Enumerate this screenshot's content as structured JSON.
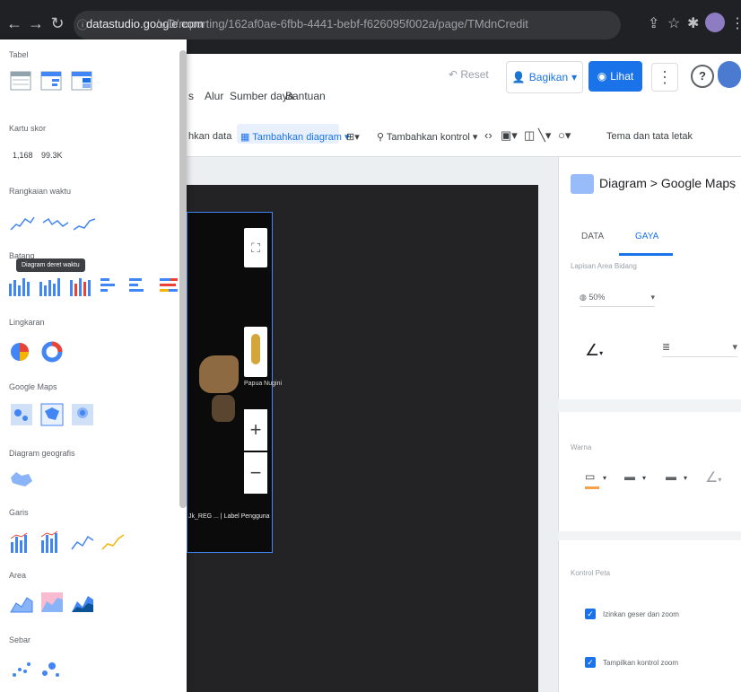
{
  "browser": {
    "url_domain": "datastudio.google.com",
    "url_path": "/u/0/reporting/162af0ae-6fbb-4441-bebf-f626095f002a/page/TMdnCredit"
  },
  "menu": {
    "items": [
      "Alur",
      "Sumber daya",
      "Bantuan"
    ],
    "partial_item": "hkan data"
  },
  "header": {
    "reset_label": "Reset",
    "share_label": "Bagikan",
    "view_label": "Lihat"
  },
  "toolbar": {
    "add_chart_label": "Tambahkan diagram",
    "add_control_label": "Tambahkan kontrol",
    "theme_label": "Tema dan tata letak"
  },
  "chart_menu": {
    "sections": [
      {
        "label": "Tabel"
      },
      {
        "label": "Kartu skor"
      },
      {
        "label": "Rangkaian waktu"
      },
      {
        "label": "Batang"
      },
      {
        "label": "Lingkaran"
      },
      {
        "label": "Google Maps"
      },
      {
        "label": "Diagram geografis"
      },
      {
        "label": "Garis"
      },
      {
        "label": "Area"
      },
      {
        "label": "Sebar"
      }
    ],
    "scorecard_values": [
      "1,168",
      "99.3K"
    ],
    "tooltip": "Diagram deret waktu"
  },
  "map": {
    "place_label": "Papua Nugini",
    "caption": "Jk_REG ... | Label Pengguna"
  },
  "panel": {
    "breadcrumb_root": "Diagram",
    "breadcrumb_sep": ">",
    "breadcrumb_leaf": "Google Maps",
    "tab_data": "DATA",
    "tab_style": "GAYA",
    "layer_label": "Lapisan Area Bidang",
    "fill_select": "50%",
    "color_section_label": "Warna",
    "map_controls_label": "Kontrol Peta",
    "checkbox1_label": "Izinkan geser dan zoom",
    "checkbox2_label": "Tampilkan kontrol zoom"
  },
  "colors": {
    "accent": "#1a73e8",
    "browser_bar": "#202124",
    "canvas": "#232326"
  }
}
